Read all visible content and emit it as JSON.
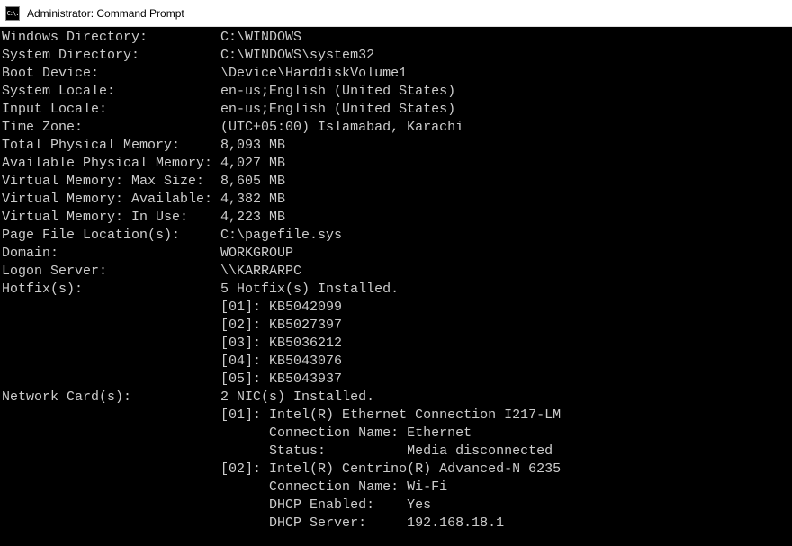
{
  "window": {
    "title": "Administrator: Command Prompt",
    "icon": "C:\\."
  },
  "entries": [
    {
      "label": "Windows Directory:",
      "value": "C:\\WINDOWS"
    },
    {
      "label": "System Directory:",
      "value": "C:\\WINDOWS\\system32"
    },
    {
      "label": "Boot Device:",
      "value": "\\Device\\HarddiskVolume1"
    },
    {
      "label": "System Locale:",
      "value": "en-us;English (United States)"
    },
    {
      "label": "Input Locale:",
      "value": "en-us;English (United States)"
    },
    {
      "label": "Time Zone:",
      "value": "(UTC+05:00) Islamabad, Karachi"
    },
    {
      "label": "Total Physical Memory:",
      "value": "8,093 MB"
    },
    {
      "label": "Available Physical Memory:",
      "value": "4,027 MB"
    },
    {
      "label": "Virtual Memory: Max Size:",
      "value": "8,605 MB"
    },
    {
      "label": "Virtual Memory: Available:",
      "value": "4,382 MB"
    },
    {
      "label": "Virtual Memory: In Use:",
      "value": "4,223 MB"
    },
    {
      "label": "Page File Location(s):",
      "value": "C:\\pagefile.sys"
    },
    {
      "label": "Domain:",
      "value": "WORKGROUP"
    },
    {
      "label": "Logon Server:",
      "value": "\\\\KARRARPC"
    },
    {
      "label": "Hotfix(s):",
      "value": "5 Hotfix(s) Installed."
    }
  ],
  "hotfixes": [
    "[01]: KB5042099",
    "[02]: KB5027397",
    "[03]: KB5036212",
    "[04]: KB5043076",
    "[05]: KB5043937"
  ],
  "network": {
    "label": "Network Card(s):",
    "header": "2 NIC(s) Installed.",
    "nics": [
      {
        "index": "[01]: Intel(R) Ethernet Connection I217-LM",
        "details": [
          {
            "k": "Connection Name:",
            "v": "Ethernet"
          },
          {
            "k": "Status:",
            "v": "Media disconnected"
          }
        ]
      },
      {
        "index": "[02]: Intel(R) Centrino(R) Advanced-N 6235",
        "details": [
          {
            "k": "Connection Name:",
            "v": "Wi-Fi"
          },
          {
            "k": "DHCP Enabled:",
            "v": "Yes"
          },
          {
            "k": "DHCP Server:",
            "v": "192.168.18.1"
          }
        ]
      }
    ]
  }
}
